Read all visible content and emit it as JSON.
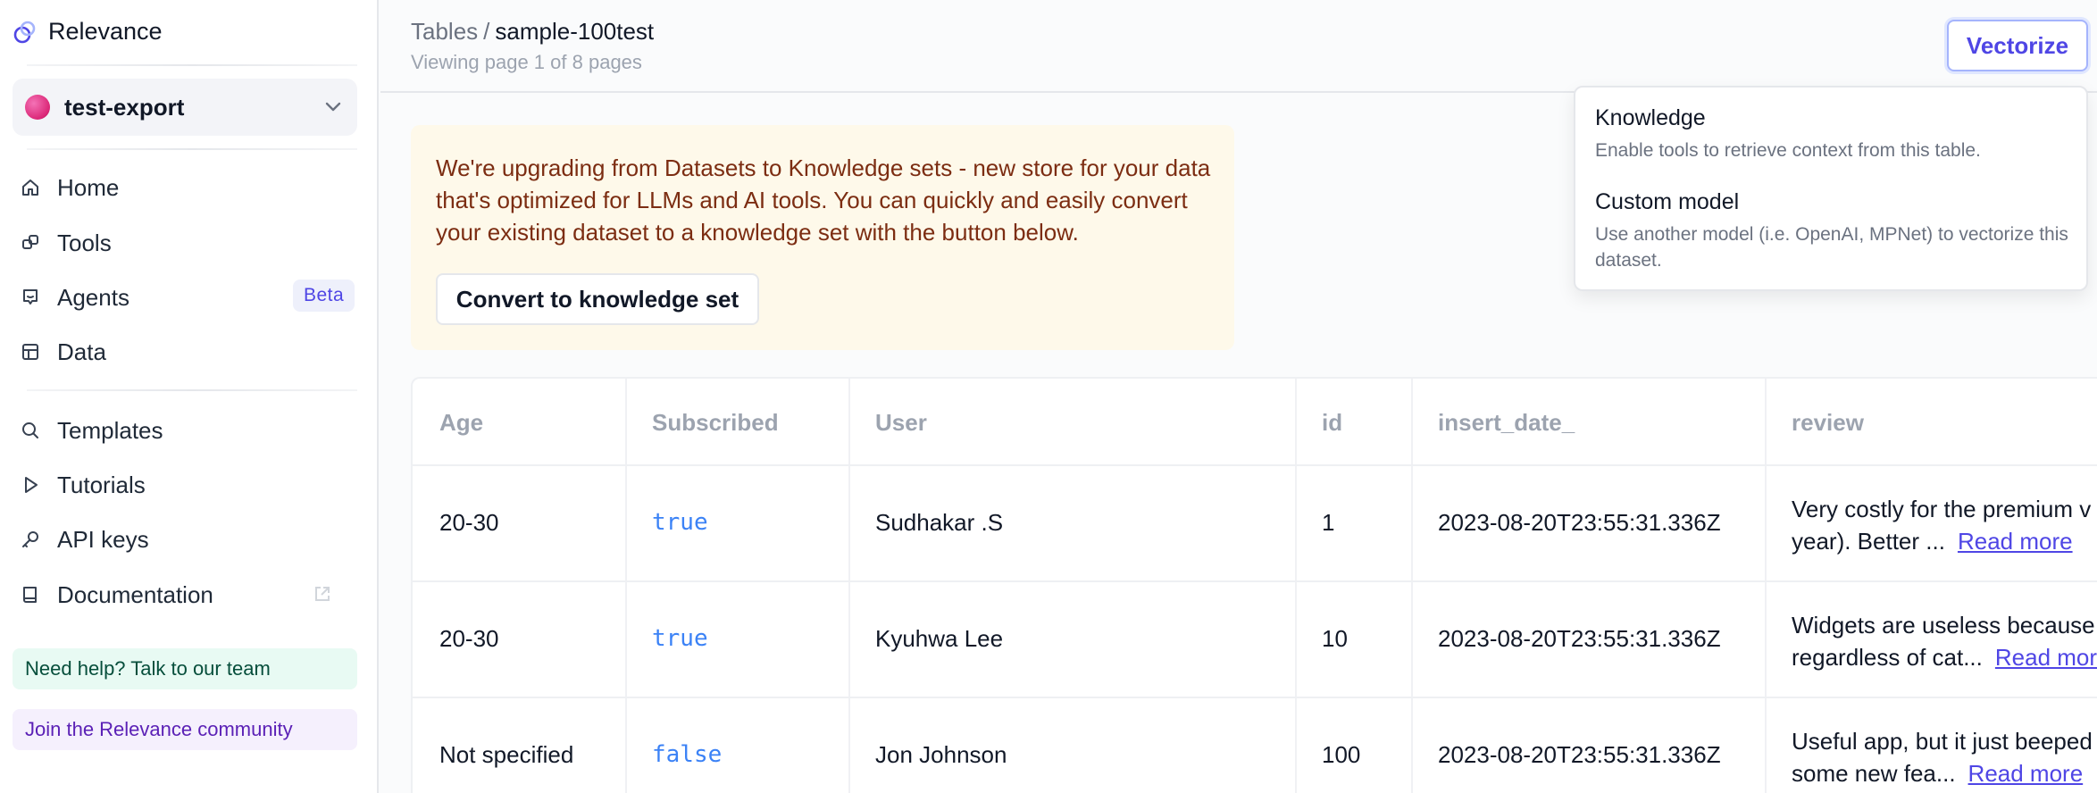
{
  "sidebar": {
    "brand": "Relevance",
    "workspace": "test-export",
    "items": [
      {
        "label": "Home",
        "icon": "home-icon"
      },
      {
        "label": "Tools",
        "icon": "tools-icon"
      },
      {
        "label": "Agents",
        "icon": "agent-icon",
        "badge": "Beta"
      },
      {
        "label": "Data",
        "icon": "table-icon"
      },
      {
        "label": "Templates",
        "icon": "search-icon"
      },
      {
        "label": "Tutorials",
        "icon": "play-icon"
      },
      {
        "label": "API keys",
        "icon": "key-icon"
      },
      {
        "label": "Documentation",
        "icon": "book-icon"
      }
    ],
    "help": "Need help? Talk to our team",
    "community": "Join the Relevance community"
  },
  "header": {
    "crumb_root": "Tables",
    "crumb_sep": "/",
    "crumb_current": "sample-100test",
    "subtitle": "Viewing page 1 of 8 pages",
    "vectorize": "Vectorize"
  },
  "dropdown": {
    "items": [
      {
        "title": "Knowledge",
        "desc": "Enable tools to retrieve context from this table."
      },
      {
        "title": "Custom model",
        "desc": "Use another model (i.e. OpenAI, MPNet) to vectorize this dataset."
      }
    ]
  },
  "banner": {
    "text": "We're upgrading from Datasets to Knowledge sets - new store for your data that's optimized for LLMs and AI tools. You can quickly and easily convert your existing dataset to a knowledge set with the button below.",
    "button": "Convert to knowledge set"
  },
  "table": {
    "columns": [
      "Age",
      "Subscribed",
      "User",
      "id",
      "insert_date_",
      "review"
    ],
    "rows": [
      {
        "age": "20-30",
        "subscribed": "true",
        "user": "Sudhakar .S",
        "id": "1",
        "date": "2023-08-20T23:55:31.336Z",
        "review1": "Very costly for the premium v",
        "review2": "year). Better ...",
        "more": "Read more"
      },
      {
        "age": "20-30",
        "subscribed": "true",
        "user": "Kyuhwa Lee",
        "id": "10",
        "date": "2023-08-20T23:55:31.336Z",
        "review1": "Widgets are useless because",
        "review2": "regardless of cat...",
        "more": "Read more"
      },
      {
        "age": "Not specified",
        "subscribed": "false",
        "user": "Jon Johnson",
        "id": "100",
        "date": "2023-08-20T23:55:31.336Z",
        "review1": "Useful app, but it just beeped",
        "review2": "some new fea...",
        "more": "Read more"
      }
    ]
  },
  "colors": {
    "accent": "#4f46e5",
    "boolean": "#3b82f6",
    "banner_bg": "#fef9ea",
    "banner_text": "#7c2d12"
  }
}
